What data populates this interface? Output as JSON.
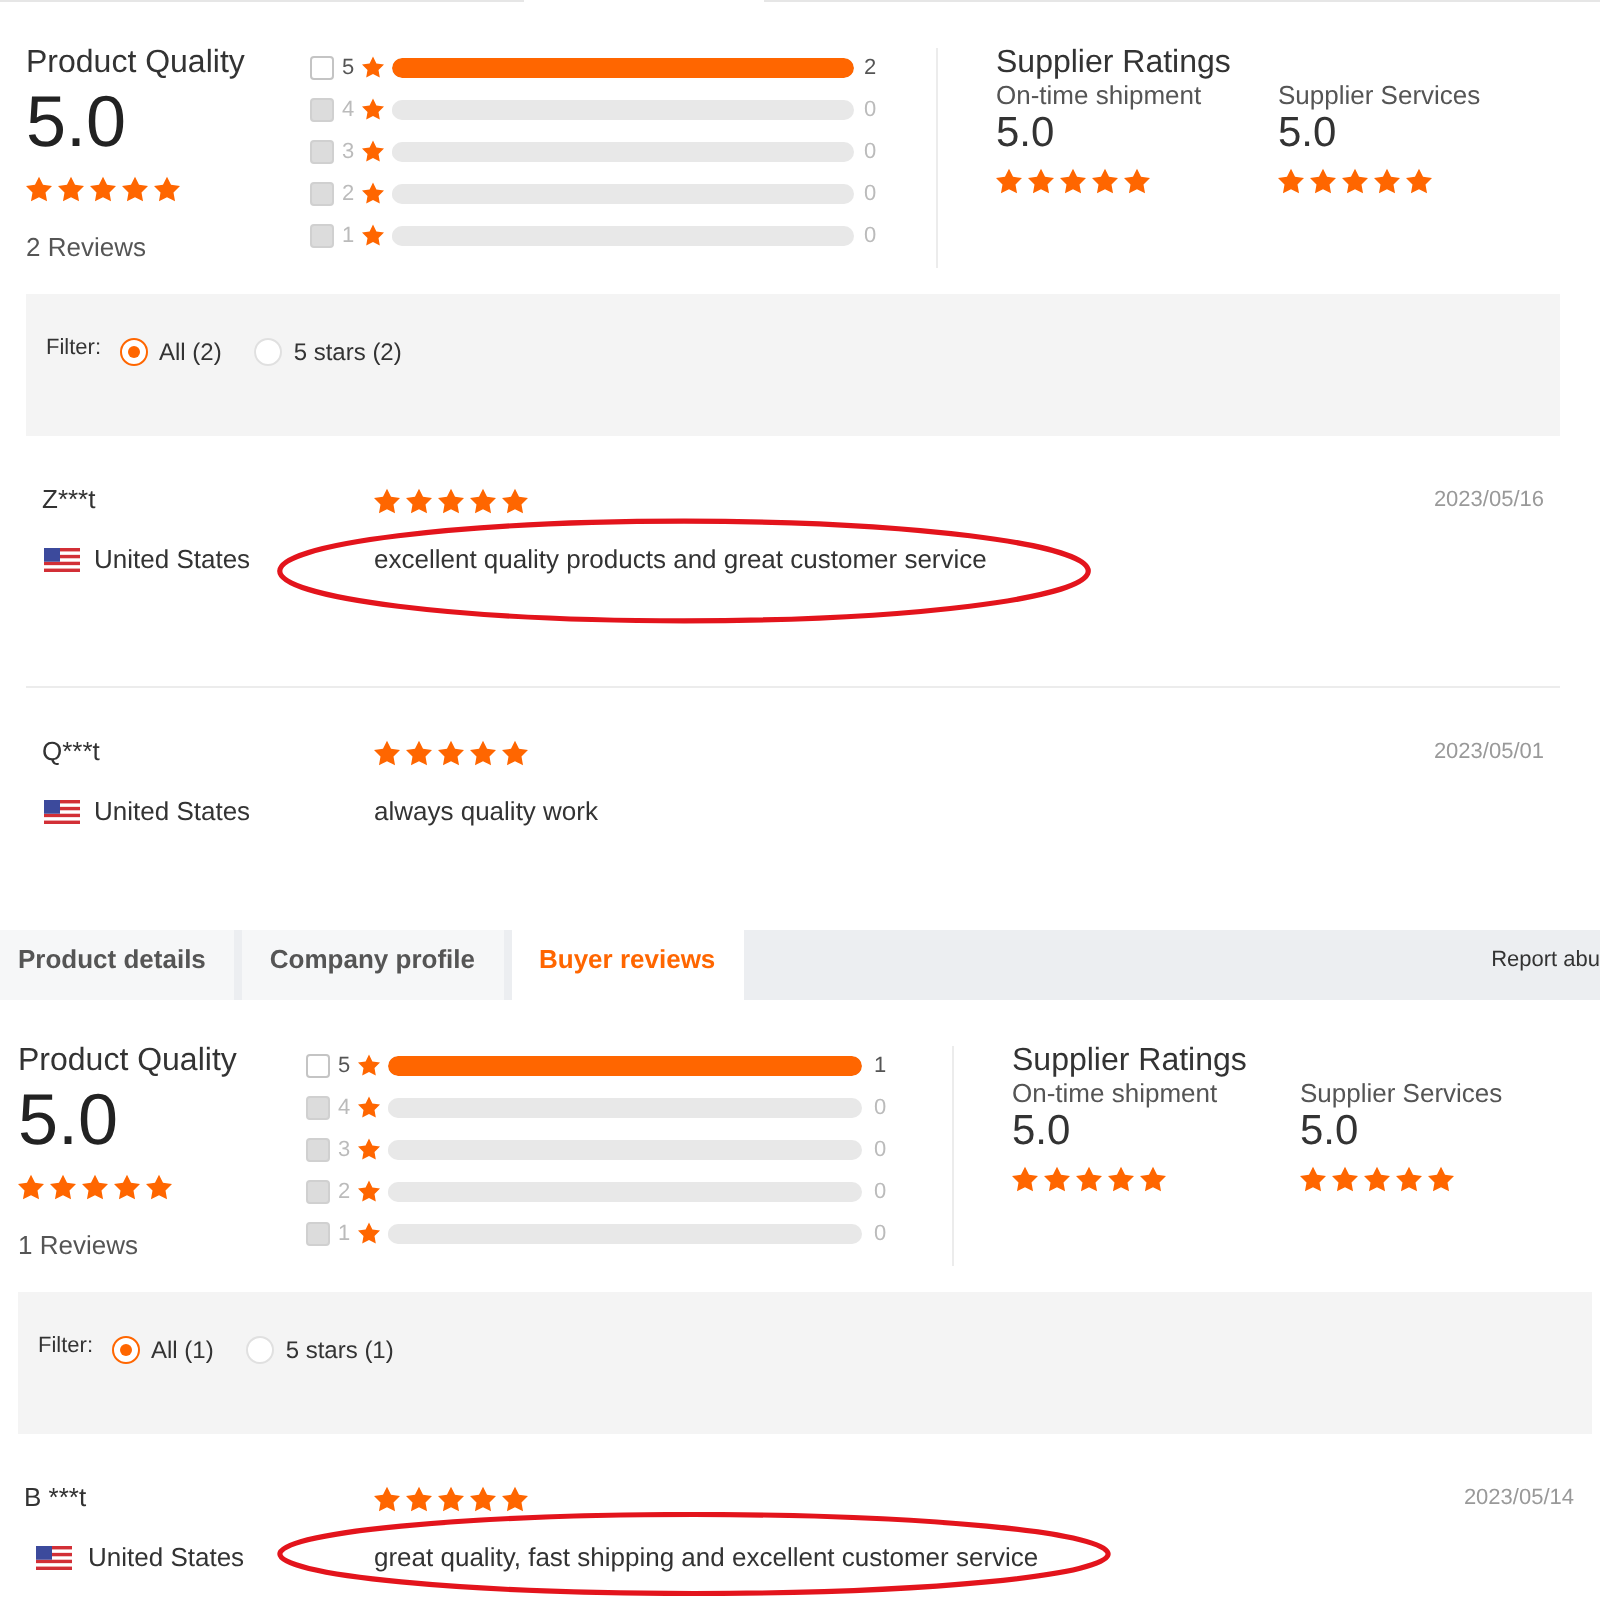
{
  "screens": [
    {
      "summary": {
        "title": "Product Quality",
        "score": "5.0",
        "stars": 5,
        "review_count": "2 Reviews"
      },
      "breakdown": [
        {
          "label": "5",
          "count": "2",
          "level": 1,
          "checked": false,
          "disabled": false
        },
        {
          "label": "4",
          "count": "0",
          "level": 0,
          "checked": false,
          "disabled": true
        },
        {
          "label": "3",
          "count": "0",
          "level": 0,
          "checked": false,
          "disabled": true
        },
        {
          "label": "2",
          "count": "0",
          "level": 0,
          "checked": false,
          "disabled": true
        },
        {
          "label": "1",
          "count": "0",
          "level": 0,
          "checked": false,
          "disabled": true
        }
      ],
      "supplier_ratings": {
        "title": "Supplier Ratings",
        "metrics": [
          {
            "label": "On-time shipment",
            "score": "5.0",
            "stars": 5
          },
          {
            "label": "Supplier Services",
            "score": "5.0",
            "stars": 5
          }
        ]
      },
      "filter": {
        "label": "Filter:",
        "options": [
          {
            "label": "All (2)",
            "selected": true
          },
          {
            "label": "5 stars (2)",
            "selected": false
          }
        ]
      },
      "reviews": [
        {
          "name": "Z***t",
          "country": "United States",
          "stars": 5,
          "date": "2023/05/16",
          "text": "excellent quality products and great customer service",
          "circled": true
        },
        {
          "name": "Q***t",
          "country": "United States",
          "stars": 5,
          "date": "2023/05/01",
          "text": "always quality work",
          "circled": false
        }
      ]
    },
    {
      "tabs": [
        {
          "label": "Product details",
          "selected": false
        },
        {
          "label": "Company profile",
          "selected": false
        },
        {
          "label": "Buyer reviews",
          "selected": true
        }
      ],
      "report_link": "Report abu",
      "summary": {
        "title": "Product Quality",
        "score": "5.0",
        "stars": 5,
        "review_count": "1 Reviews"
      },
      "breakdown": [
        {
          "label": "5",
          "count": "1",
          "level": 1,
          "checked": false,
          "disabled": false
        },
        {
          "label": "4",
          "count": "0",
          "level": 0,
          "checked": false,
          "disabled": true
        },
        {
          "label": "3",
          "count": "0",
          "level": 0,
          "checked": false,
          "disabled": true
        },
        {
          "label": "2",
          "count": "0",
          "level": 0,
          "checked": false,
          "disabled": true
        },
        {
          "label": "1",
          "count": "0",
          "level": 0,
          "checked": false,
          "disabled": true
        }
      ],
      "supplier_ratings": {
        "title": "Supplier Ratings",
        "metrics": [
          {
            "label": "On-time shipment",
            "score": "5.0",
            "stars": 5
          },
          {
            "label": "Supplier Services",
            "score": "5.0",
            "stars": 5
          }
        ]
      },
      "filter": {
        "label": "Filter:",
        "options": [
          {
            "label": "All (1)",
            "selected": true
          },
          {
            "label": "5 stars (1)",
            "selected": false
          }
        ]
      },
      "reviews": [
        {
          "name": "B ***t",
          "country": "United States",
          "stars": 5,
          "date": "2023/05/14",
          "text": "great quality, fast shipping and excellent customer service",
          "circled": true
        }
      ]
    }
  ]
}
